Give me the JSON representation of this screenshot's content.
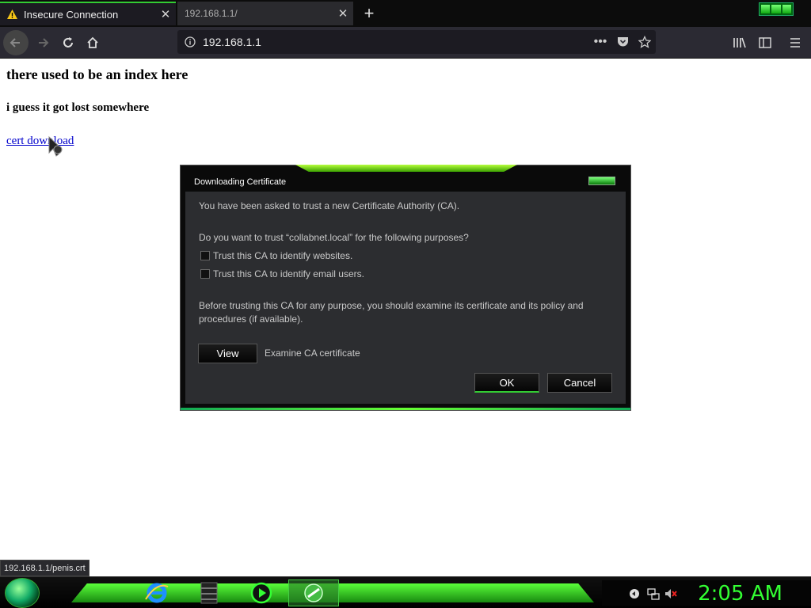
{
  "browser": {
    "tabs": [
      {
        "title": "Insecure Connection",
        "active": true
      },
      {
        "title": "192.168.1.1/",
        "active": false
      }
    ],
    "new_tab_glyph": "+",
    "url": "192.168.1.1",
    "status_url": "192.168.1.1/penis.crt"
  },
  "page": {
    "heading": "there used to be an index here",
    "subheading": "i guess it got lost somewhere",
    "link_text": "cert download"
  },
  "dialog": {
    "title": "Downloading Certificate",
    "intro": "You have been asked to trust a new Certificate Authority (CA).",
    "question": "Do you want to trust “collabnet.local” for the following purposes?",
    "checkboxes": [
      {
        "label": "Trust this CA to identify websites.",
        "checked": false
      },
      {
        "label": "Trust this CA to identify email users.",
        "checked": false
      }
    ],
    "warning": "Before trusting this CA for any purpose, you should examine its certificate and its policy and procedures (if available).",
    "view_button": "View",
    "view_description": "Examine CA certificate",
    "ok_button": "OK",
    "cancel_button": "Cancel"
  },
  "taskbar": {
    "apps": [
      "internet-explorer-icon",
      "winrar-icon",
      "media-player-icon",
      "active-window-icon"
    ],
    "clock": "2:05 AM"
  },
  "colors": {
    "accent_green": "#33cc33",
    "link_blue": "#0000cc",
    "dialog_bg": "#2c2d30"
  }
}
